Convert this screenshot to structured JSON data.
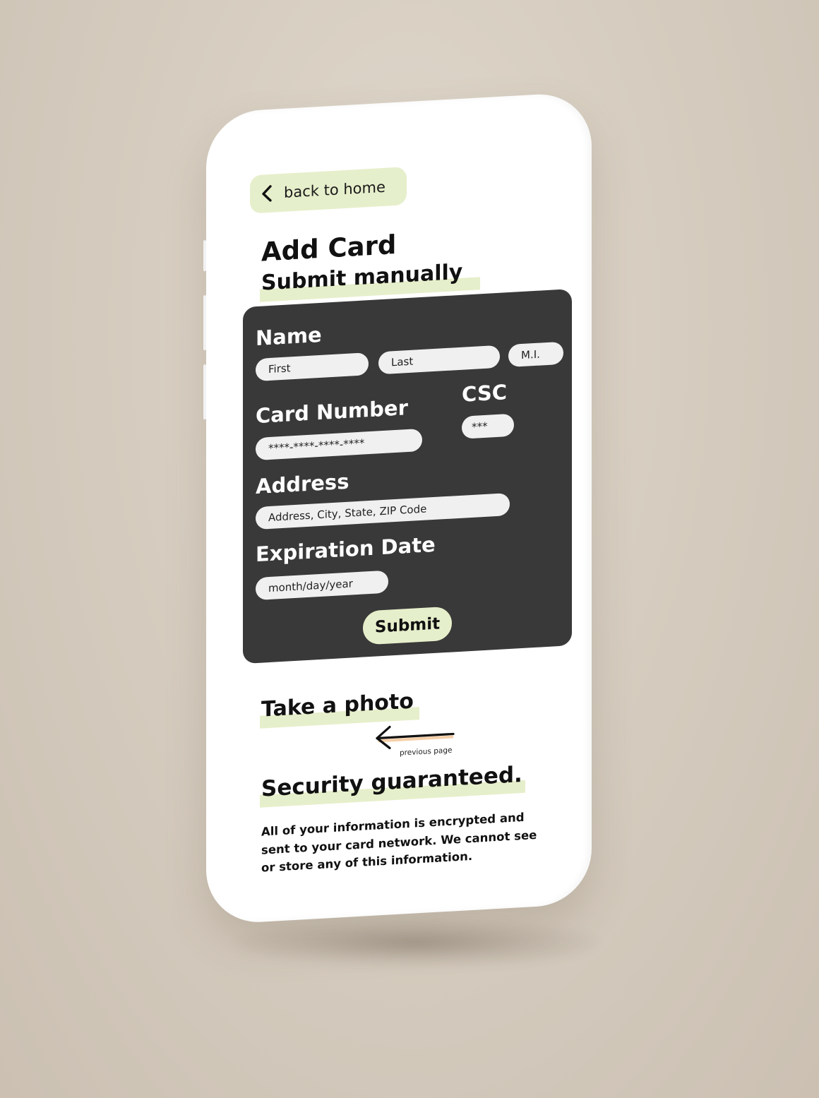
{
  "nav": {
    "back_label": "back to home",
    "back_icon": "chevron-left-icon"
  },
  "page": {
    "title": "Add Card",
    "submit_manually": "Submit manually",
    "take_photo": "Take a photo",
    "previous_page": "previous page"
  },
  "form": {
    "name": {
      "label": "Name",
      "first_placeholder": "First",
      "last_placeholder": "Last",
      "mi_placeholder": "M.I."
    },
    "card_number": {
      "label": "Card Number",
      "placeholder": "****-****-****-****"
    },
    "csc": {
      "label": "CSC",
      "placeholder": "***"
    },
    "address": {
      "label": "Address",
      "placeholder": "Address, City, State, ZIP Code"
    },
    "expiration": {
      "label": "Expiration Date",
      "placeholder": "month/day/year"
    },
    "submit_label": "Submit"
  },
  "security": {
    "title": "Security guaranteed.",
    "body": "All of your information is encrypted and sent to your card network. We cannot see or store any of this information."
  },
  "colors": {
    "accent": "#e6efcb",
    "panel": "#393939",
    "background": "#d9d0c4",
    "arrow_underline": "#f5cfa8"
  }
}
